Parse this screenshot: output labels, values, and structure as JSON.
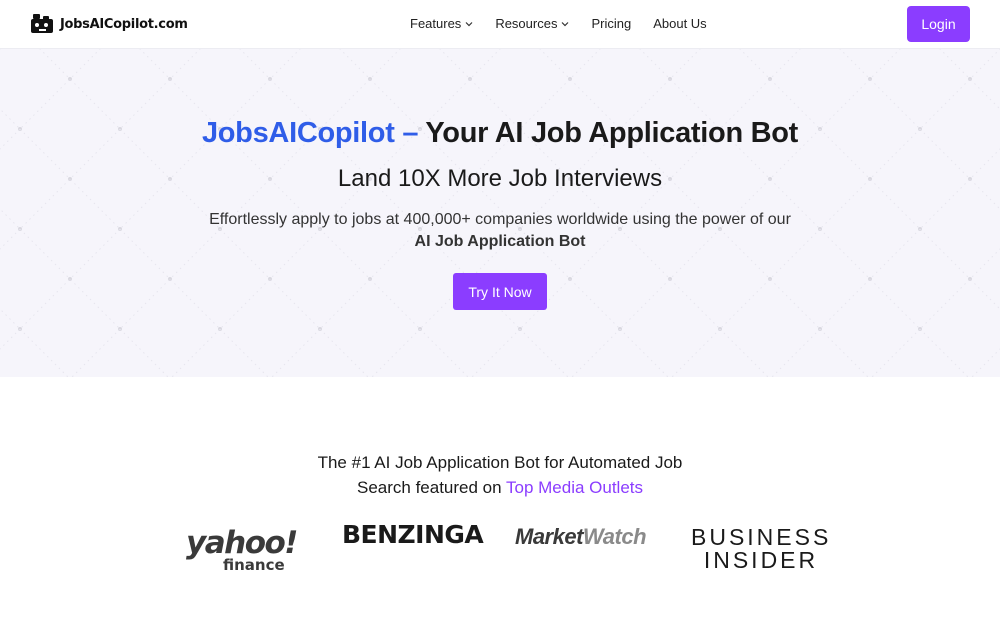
{
  "nav": {
    "brand": "JobsAICopilot.com",
    "items": [
      {
        "label": "Features",
        "has_dropdown": true
      },
      {
        "label": "Resources",
        "has_dropdown": true
      },
      {
        "label": "Pricing",
        "has_dropdown": false
      },
      {
        "label": "About Us",
        "has_dropdown": false
      }
    ],
    "login_label": "Login"
  },
  "hero": {
    "title_accent": "JobsAICopilot –",
    "title_rest": " Your AI Job Application Bot",
    "subtitle": "Land 10X More Job Interviews",
    "description_line1": "Effortlessly apply to jobs at 400,000+ companies worldwide using the power of our",
    "description_line2": "AI Job Application Bot",
    "cta_label": "Try It Now"
  },
  "featured": {
    "line1": "The #1 AI Job Application Bot for Automated Job",
    "line2_prefix": "Search featured on ",
    "line2_highlight": "Top Media Outlets"
  },
  "logos": {
    "yahoo_main": "yahoo!",
    "yahoo_sub": "finance",
    "benzinga": "BENZINGA",
    "marketwatch_a": "Market",
    "marketwatch_b": "Watch",
    "bi_line1": "BUSINESS",
    "bi_line2": "INSIDER"
  },
  "colors": {
    "accent_purple": "#8b3dff",
    "accent_blue": "#2f5de8",
    "hero_bg": "#f6f5fb"
  }
}
